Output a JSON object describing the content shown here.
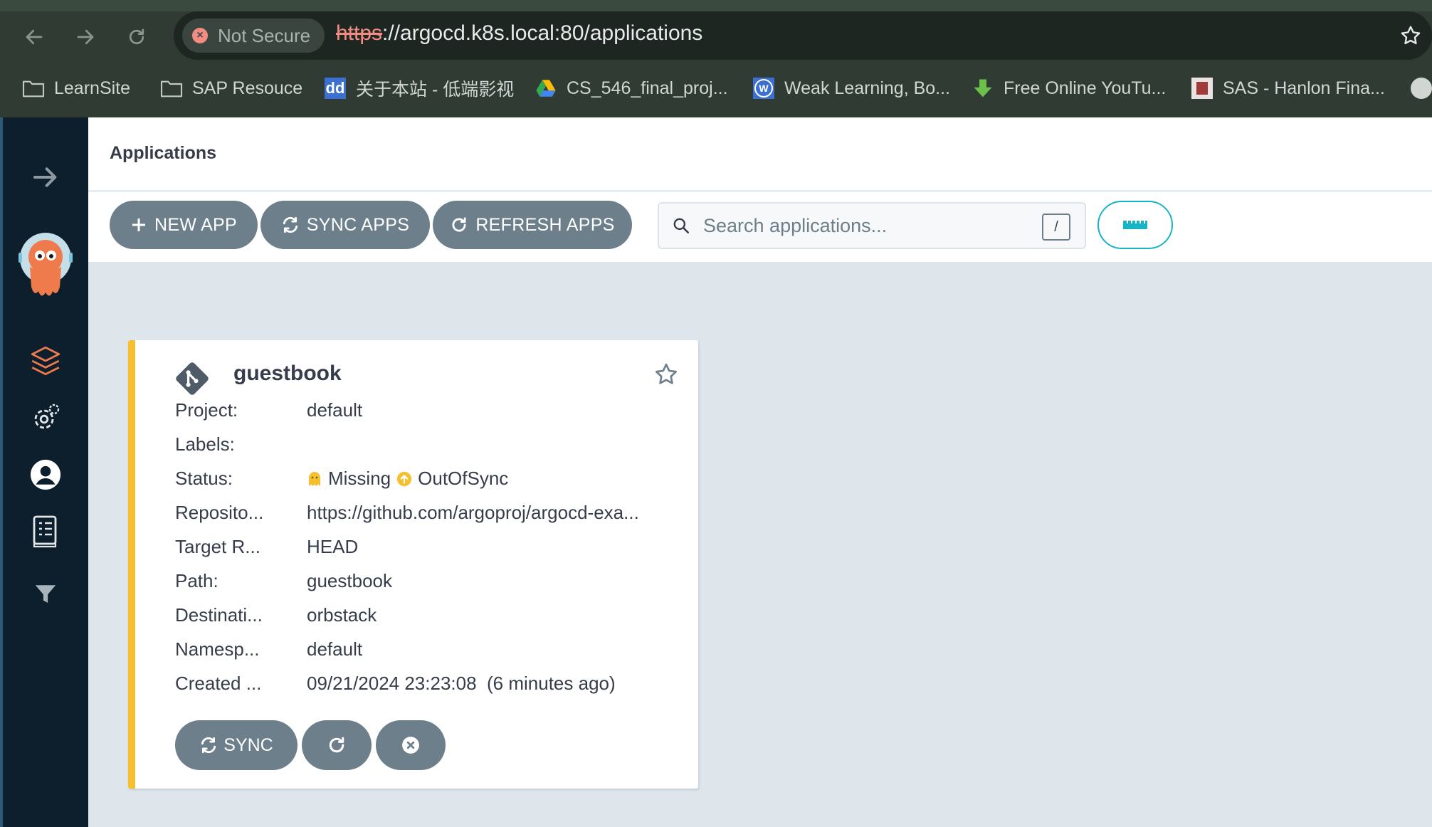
{
  "browser": {
    "security_label": "Not Secure",
    "url_scheme": "https",
    "url_rest": "://argocd.k8s.local:80/applications",
    "bookmarks": [
      {
        "label": "LearnSite",
        "icon": "folder-icon"
      },
      {
        "label": "SAP Resouce",
        "icon": "folder-icon"
      },
      {
        "label": "关于本站 - 低端影视",
        "icon": "dd-site-icon"
      },
      {
        "label": "CS_546_final_proj...",
        "icon": "google-drive-icon"
      },
      {
        "label": "Weak Learning, Bo...",
        "icon": "wordpress-icon"
      },
      {
        "label": "Free Online YouTu...",
        "icon": "download-arrow-icon"
      },
      {
        "label": "SAS - Hanlon Fina...",
        "icon": "stevens-icon"
      }
    ]
  },
  "header": {
    "title": "Applications"
  },
  "toolbar": {
    "new_app": "NEW APP",
    "sync_apps": "SYNC APPS",
    "refresh_apps": "REFRESH APPS",
    "search_placeholder": "Search applications...",
    "search_shortcut": "/"
  },
  "app": {
    "name": "guestbook",
    "fields": [
      {
        "label": "Project:",
        "value": "default"
      },
      {
        "label": "Labels:",
        "value": ""
      },
      {
        "label": "Status:",
        "health": "Missing",
        "sync": "OutOfSync"
      },
      {
        "label": "Reposito...",
        "value": "https://github.com/argoproj/argocd-exa..."
      },
      {
        "label": "Target R...",
        "value": "HEAD"
      },
      {
        "label": "Path:",
        "value": "guestbook"
      },
      {
        "label": "Destinati...",
        "value": "orbstack"
      },
      {
        "label": "Namesp...",
        "value": "default"
      },
      {
        "label": "Created ...",
        "value": "09/21/2024 23:23:08  (6 minutes ago)"
      }
    ],
    "sync_button": "SYNC"
  },
  "colors": {
    "status_bar": "#f4c030",
    "button": "#6d7f8b",
    "accent": "#18b4c6",
    "sidebar": "#0d1f2d"
  }
}
